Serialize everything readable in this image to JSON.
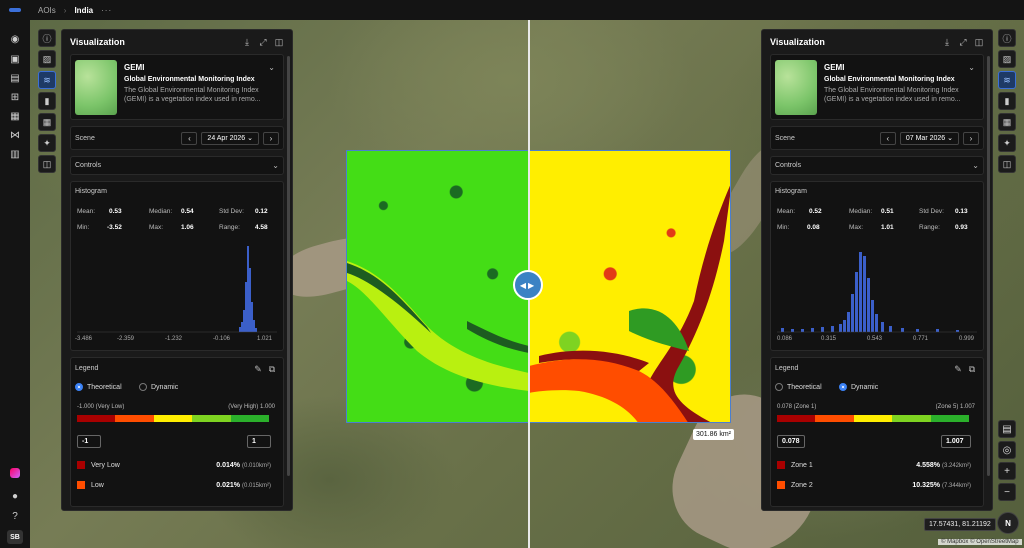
{
  "breadcrumb": {
    "root": "AOIs",
    "current": "India",
    "more": "···"
  },
  "rail": {
    "icons": [
      "compass-icon",
      "box-icon",
      "truck-icon",
      "cart-icon",
      "map-icon",
      "flow-icon",
      "store-icon"
    ],
    "avatar": "SB"
  },
  "left_panel": {
    "title": "Visualization",
    "index": {
      "name": "GEMI",
      "full_name": "Global Environmental Monitoring Index",
      "description": "The Global Environmental Monitoring Index (GEMI) is a vegetation index used in remo..."
    },
    "scene_label": "Scene",
    "scene_date": "24 Apr 2026",
    "controls_label": "Controls",
    "histogram": {
      "title": "Histogram",
      "mean_label": "Mean:",
      "mean": "0.53",
      "median_label": "Median:",
      "median": "0.54",
      "std_label": "Std Dev:",
      "std": "0.12",
      "min_label": "Min:",
      "min": "-3.52",
      "max_label": "Max:",
      "max": "1.06",
      "range_label": "Range:",
      "range": "4.58",
      "ticks": [
        "-3.486",
        "-2.359",
        "-1.232",
        "-0.106",
        "1.021"
      ]
    },
    "legend": {
      "title": "Legend",
      "theoretical": "Theoretical",
      "dynamic": "Dynamic",
      "selected": "theoretical",
      "range_low": "-1.000 (Very Low)",
      "range_high": "(Very High) 1.000",
      "input_low": "-1",
      "input_high": "1",
      "zones": [
        {
          "label": "Very Low",
          "pct": "0.014%",
          "area": "(0.010km²)",
          "color": "#a80000"
        },
        {
          "label": "Low",
          "pct": "0.021%",
          "area": "(0.015km²)",
          "color": "#ff4d00"
        }
      ]
    }
  },
  "right_panel": {
    "title": "Visualization",
    "index": {
      "name": "GEMI",
      "full_name": "Global Environmental Monitoring Index",
      "description": "The Global Environmental Monitoring Index (GEMI) is a vegetation index used in remo..."
    },
    "scene_label": "Scene",
    "scene_date": "07 Mar 2026",
    "controls_label": "Controls",
    "histogram": {
      "title": "Histogram",
      "mean_label": "Mean:",
      "mean": "0.52",
      "median_label": "Median:",
      "median": "0.51",
      "std_label": "Std Dev:",
      "std": "0.13",
      "min_label": "Min:",
      "min": "0.08",
      "max_label": "Max:",
      "max": "1.01",
      "range_label": "Range:",
      "range": "0.93",
      "ticks": [
        "0.086",
        "0.315",
        "0.543",
        "0.771",
        "0.999"
      ]
    },
    "legend": {
      "title": "Legend",
      "theoretical": "Theoretical",
      "dynamic": "Dynamic",
      "selected": "dynamic",
      "range_low": "0.078 (Zone 1)",
      "range_high": "(Zone 5) 1.007",
      "input_low": "0.078",
      "input_high": "1.007",
      "zones": [
        {
          "label": "Zone 1",
          "pct": "4.558%",
          "area": "(3.242km²)",
          "color": "#a80000"
        },
        {
          "label": "Zone 2",
          "pct": "10.325%",
          "area": "(7.344km²)",
          "color": "#ff4d00"
        }
      ]
    }
  },
  "legend_colors": [
    "#a80000",
    "#ff4d00",
    "#ffee00",
    "#7ed321",
    "#2bb02b"
  ],
  "map": {
    "area_label": "301.86 km²",
    "coords": "17.57431, 81.21192",
    "attribution": "© Mapbox © OpenStreetMap",
    "compass": "N",
    "zoom_in": "+",
    "zoom_out": "−"
  }
}
